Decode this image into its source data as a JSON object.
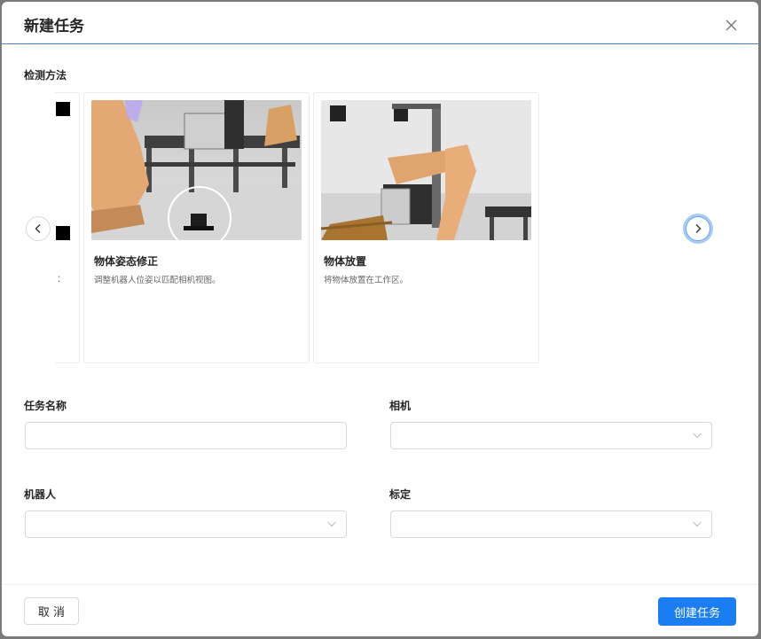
{
  "dialog": {
    "title": "新建任务",
    "close_icon": "close-icon"
  },
  "detection": {
    "label": "检测方法",
    "cards": [
      {
        "title": "物体姿态修正",
        "description": "调整机器人位姿以匹配相机视图。",
        "image": "robot-pose-correction-render"
      },
      {
        "title": "物体放置",
        "description": "将物体放置在工作区。",
        "image": "robot-object-placement-render"
      }
    ],
    "partial_card_text": "：",
    "prev_icon": "chevron-left-icon",
    "next_icon": "chevron-right-icon"
  },
  "form": {
    "task_name_label": "任务名称",
    "task_name_value": "",
    "camera_label": "相机",
    "camera_value": "",
    "robot_label": "机器人",
    "robot_value": "",
    "calibration_label": "标定",
    "calibration_value": ""
  },
  "footer": {
    "cancel_label": "取 消",
    "create_label": "创建任务"
  },
  "colors": {
    "primary": "#1a7ef2",
    "header_divider": "#4d7fc4",
    "focus_ring": "#a8cbf3"
  }
}
